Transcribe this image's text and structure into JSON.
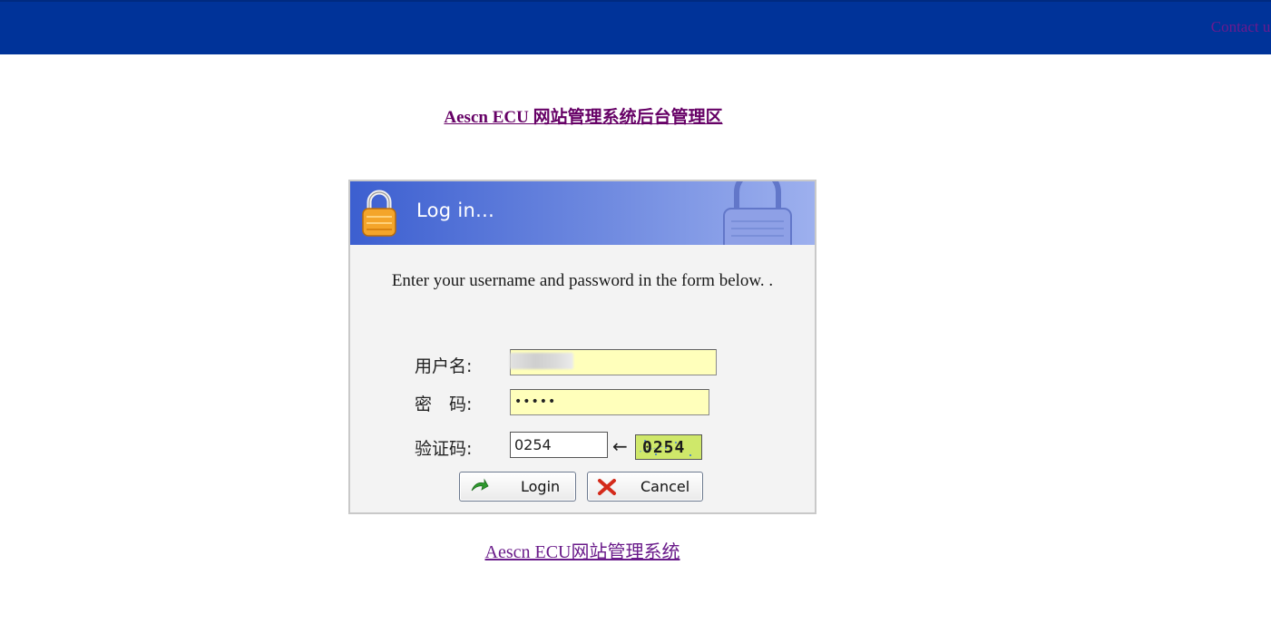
{
  "header": {
    "contact_label": "Contact us",
    "bar_color": "#003399"
  },
  "site_title": "Aescn ECU 网站管理系统后台管理区",
  "login_panel": {
    "title": "Log in...",
    "intro": "Enter your username and password in the form below. .",
    "fields": {
      "username_label": "用户名:",
      "username_value": "",
      "password_label": "密　码:",
      "password_value": "•••••",
      "captcha_label": "验证码:",
      "captcha_value": "0254",
      "captcha_image_text": "0254"
    },
    "buttons": {
      "login_label": "Login",
      "cancel_label": "Cancel"
    }
  },
  "footer_link": "Aescn ECU网站管理系统",
  "colors": {
    "input_bg": "#ffffbb",
    "link": "#660066",
    "panel_header": "#6f8ae0"
  }
}
